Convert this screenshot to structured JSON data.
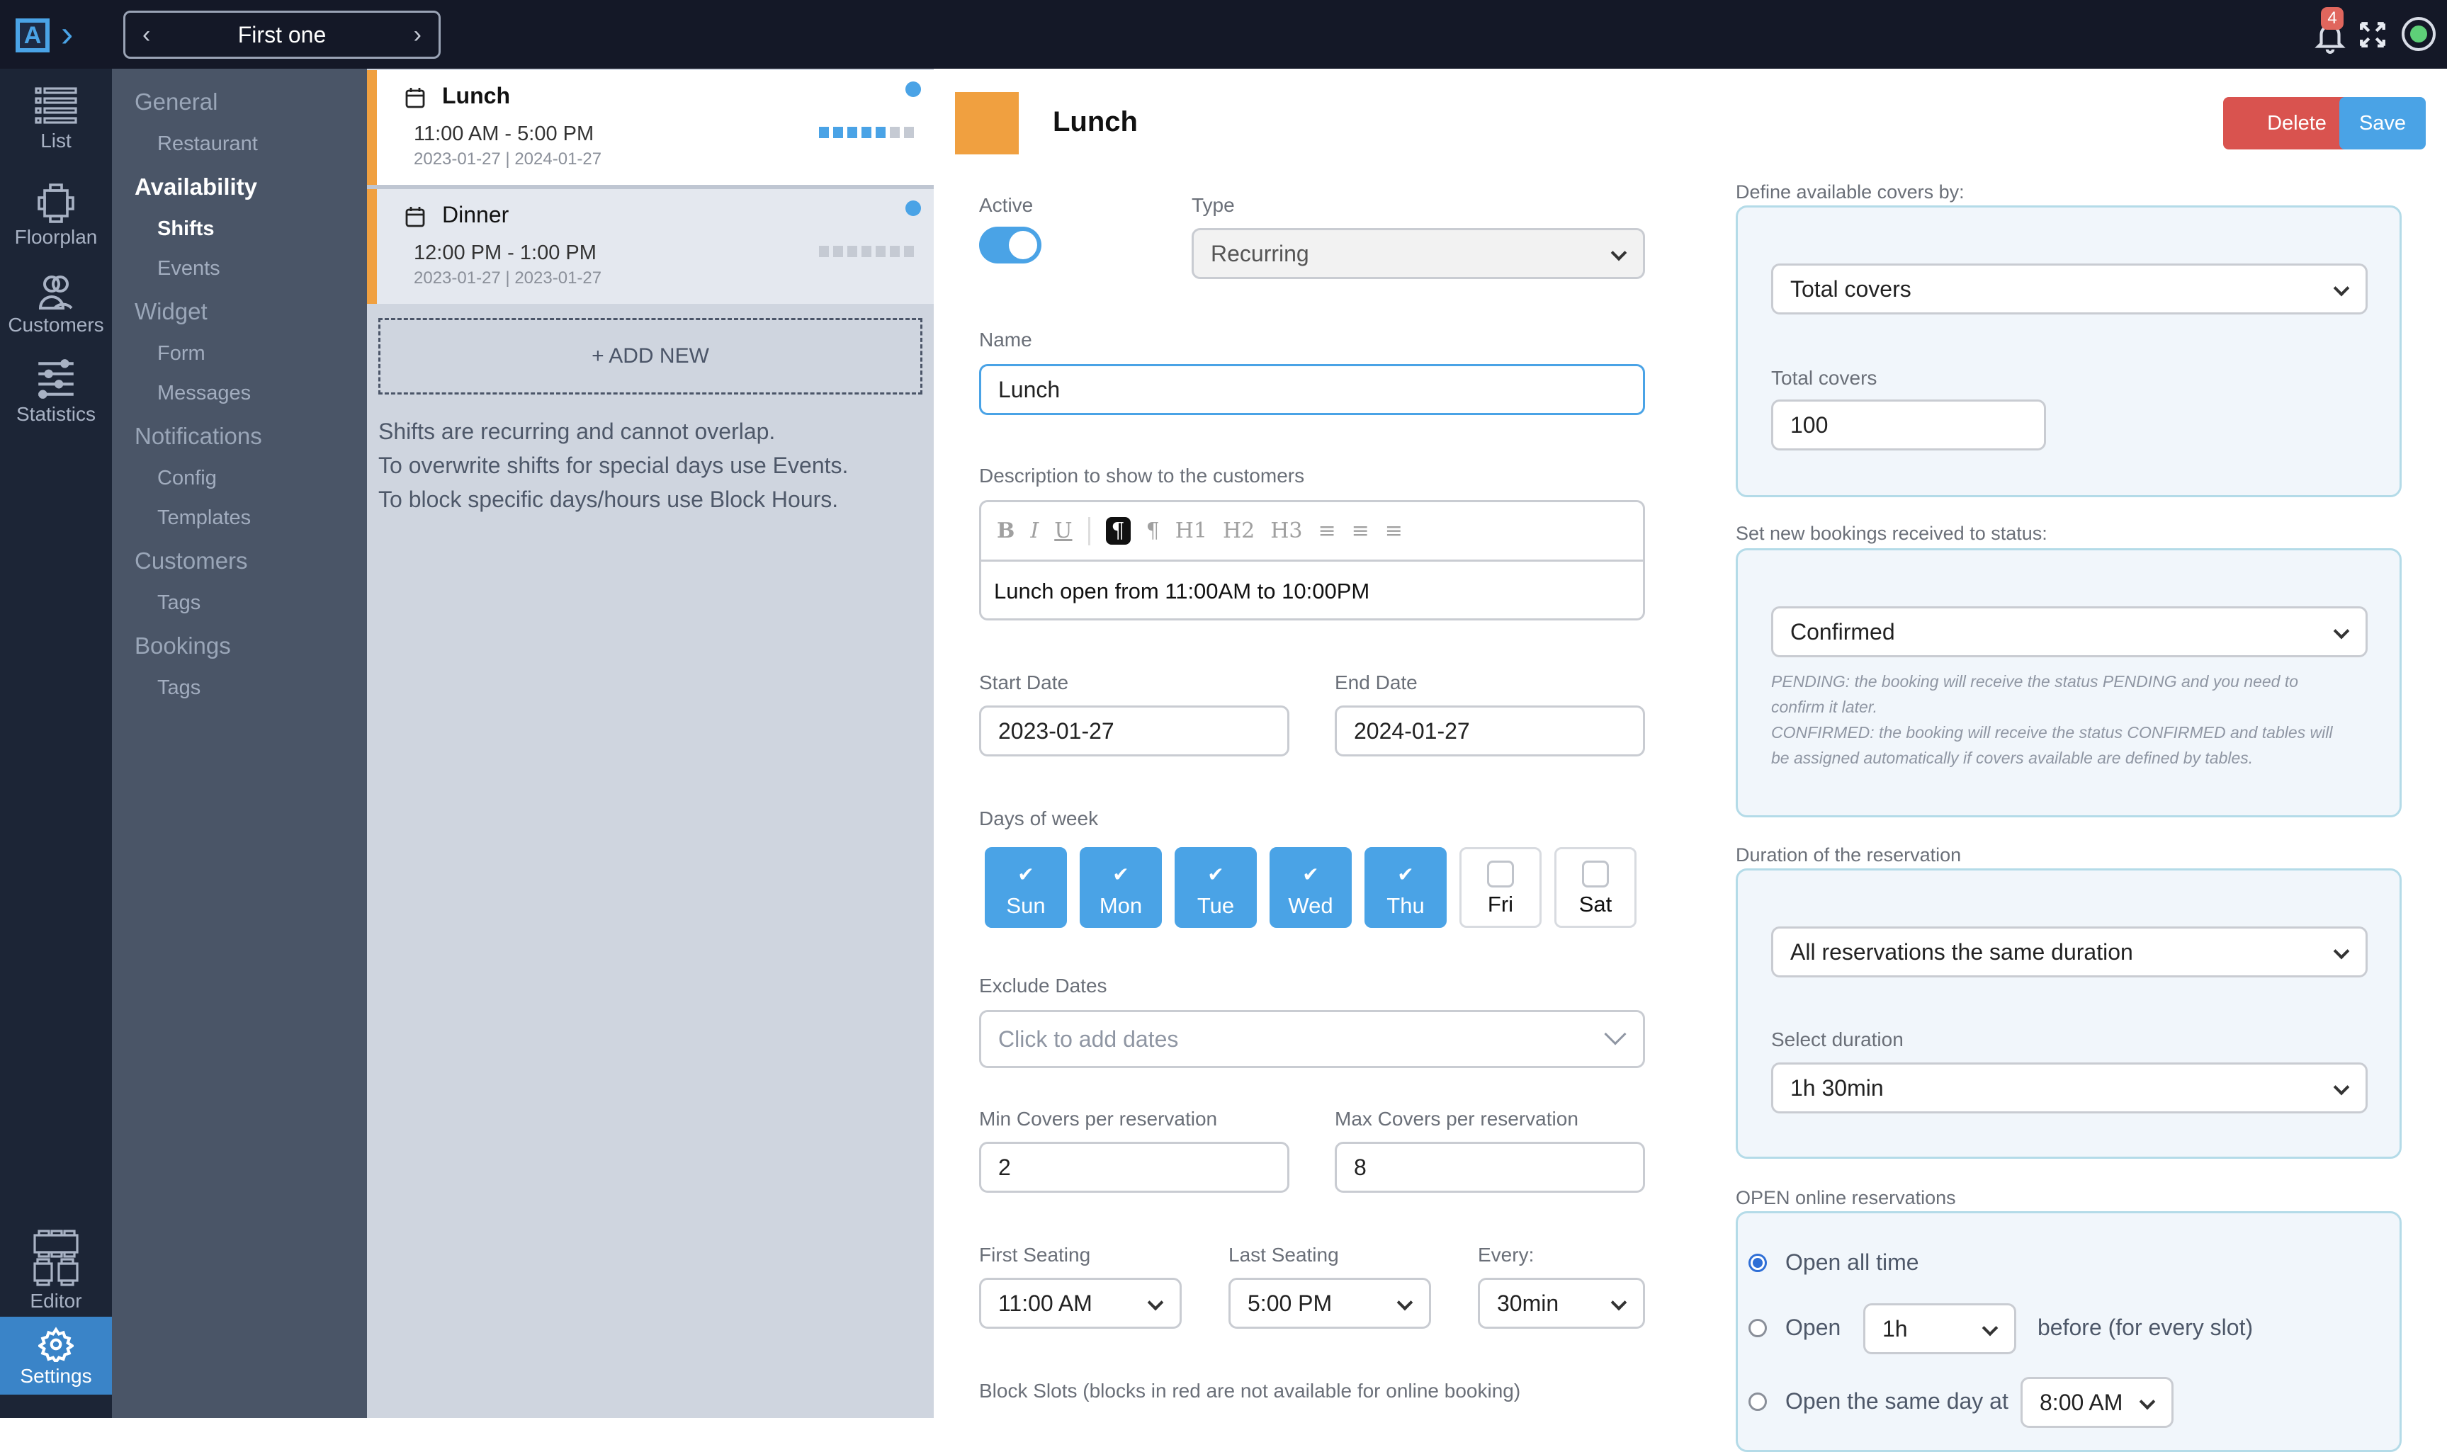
{
  "topbar": {
    "logo_letter": "A",
    "current_shift_title": "First one",
    "notification_count": "4",
    "colors": {
      "background": "#141827",
      "accent": "#4aa3e6",
      "badge": "#e0665d",
      "status_online": "#5ed078"
    }
  },
  "rail": {
    "items": [
      {
        "label": "List",
        "icon": "list-icon"
      },
      {
        "label": "Floorplan",
        "icon": "table-icon"
      },
      {
        "label": "Customers",
        "icon": "users-icon"
      },
      {
        "label": "Statistics",
        "icon": "sliders-icon"
      },
      {
        "label": "Editor",
        "icon": "tables-layout-icon"
      },
      {
        "label": "Settings",
        "icon": "gear-icon",
        "active": true
      }
    ]
  },
  "settings_nav": {
    "sections": [
      {
        "label": "General",
        "items": [
          "Restaurant"
        ]
      },
      {
        "label": "Availability",
        "active": true,
        "items": [
          "Shifts",
          "Events"
        ],
        "active_item": "Shifts"
      },
      {
        "label": "Widget",
        "items": [
          "Form",
          "Messages"
        ]
      },
      {
        "label": "Notifications",
        "items": [
          "Config",
          "Templates"
        ]
      },
      {
        "label": "Customers",
        "items": [
          "Tags"
        ]
      },
      {
        "label": "Bookings",
        "items": [
          "Tags"
        ]
      }
    ]
  },
  "shift_list": {
    "shifts": [
      {
        "name": "Lunch",
        "time": "11:00 AM - 5:00 PM",
        "dates": "2023-01-27 | 2024-01-27",
        "selected": true,
        "color": "#f0a040",
        "weekdays_active": [
          true,
          true,
          true,
          true,
          true,
          false,
          false
        ]
      },
      {
        "name": "Dinner",
        "time": "12:00 PM - 1:00 PM",
        "dates": "2023-01-27 | 2023-01-27",
        "selected": false,
        "color": "#f0a040",
        "weekdays_active": [
          false,
          false,
          false,
          false,
          false,
          false,
          false
        ]
      }
    ],
    "add_new_label": "+ ADD NEW",
    "info_lines": [
      "Shifts are recurring and cannot overlap.",
      "To overwrite shifts for special days use Events.",
      "To block specific days/hours use Block Hours."
    ]
  },
  "form": {
    "title": "Lunch",
    "color": "#f0a040",
    "delete_label": "Delete",
    "save_label": "Save",
    "active_label": "Active",
    "active": true,
    "type_label": "Type",
    "type_value": "Recurring",
    "name_label": "Name",
    "name_value": "Lunch",
    "description_label": "Description to show to the customers",
    "description_toolbar": [
      "B",
      "I",
      "U",
      "¶",
      "¶",
      "H1",
      "H2",
      "H3",
      "≡",
      "≡",
      "≡"
    ],
    "description_value": "Lunch open from 11:00AM to 10:00PM",
    "start_date_label": "Start Date",
    "start_date": "2023-01-27",
    "end_date_label": "End Date",
    "end_date": "2024-01-27",
    "days_label": "Days of week",
    "days": [
      {
        "label": "Sun",
        "checked": true
      },
      {
        "label": "Mon",
        "checked": true
      },
      {
        "label": "Tue",
        "checked": true
      },
      {
        "label": "Wed",
        "checked": true
      },
      {
        "label": "Thu",
        "checked": true
      },
      {
        "label": "Fri",
        "checked": false
      },
      {
        "label": "Sat",
        "checked": false
      }
    ],
    "exclude_label": "Exclude Dates",
    "exclude_placeholder": "Click to add dates",
    "min_covers_label": "Min Covers per reservation",
    "min_covers": "2",
    "max_covers_label": "Max Covers per reservation",
    "max_covers": "8",
    "first_seating_label": "First Seating",
    "first_seating": "11:00 AM",
    "last_seating_label": "Last Seating",
    "last_seating": "5:00 PM",
    "every_label": "Every:",
    "every": "30min",
    "block_slots_label": "Block Slots (blocks in red are not available for online booking)"
  },
  "right": {
    "covers_title": "Define available covers by:",
    "covers_mode": "Total covers",
    "total_covers_label": "Total covers",
    "total_covers": "100",
    "status_title": "Set new bookings received to status:",
    "status_value": "Confirmed",
    "status_hint_pending": "PENDING: the booking will receive the status PENDING and you need to confirm it later.",
    "status_hint_confirmed": "CONFIRMED: the booking will receive the status CONFIRMED and tables will be assigned automatically if covers available are defined by tables.",
    "duration_title": "Duration of the reservation",
    "duration_mode": "All reservations the same duration",
    "select_duration_label": "Select duration",
    "duration_value": "1h 30min",
    "open_title": "OPEN online reservations",
    "open_options": [
      {
        "label": "Open all time",
        "selected": true
      },
      {
        "label": "Open",
        "suffix": "before (for every slot)",
        "select_value": "1h",
        "selected": false
      },
      {
        "label": "Open the same day at",
        "select_value": "8:00 AM",
        "selected": false
      }
    ]
  }
}
